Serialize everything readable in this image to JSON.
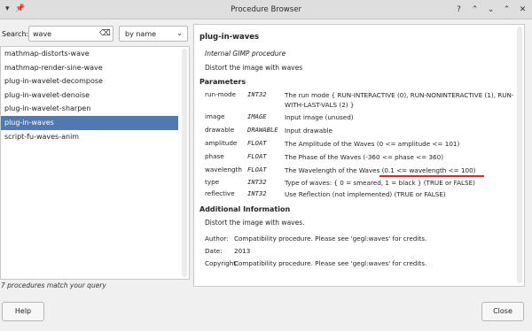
{
  "window": {
    "title": "Procedure Browser",
    "pin_glyph": "📌",
    "controls": [
      "?",
      "⌃",
      "⌄",
      "⌃",
      "✕"
    ]
  },
  "search": {
    "label": "Search:",
    "value": "wave",
    "clear_glyph": "⌫",
    "sort": "by name",
    "sort_chevron": "⌄"
  },
  "procedures": [
    "mathmap-distorts-wave",
    "mathmap-render-sine-wave",
    "plug-in-wavelet-decompose",
    "plug-in-wavelet-denoise",
    "plug-in-wavelet-sharpen",
    "plug-in-waves",
    "script-fu-waves-anim"
  ],
  "selected_procedure": "plug-in-waves",
  "status": "7 procedures match your query",
  "details": {
    "name": "plug-in-waves",
    "kind": "Internal GIMP procedure",
    "blurb": "Distort the image with waves",
    "parameters_heading": "Parameters",
    "parameters": [
      {
        "name": "run-mode",
        "type": "INT32",
        "desc": "The run mode { RUN-INTERACTIVE (0), RUN-NONINTERACTIVE (1), RUN-WITH-LAST-VALS (2) }"
      },
      {
        "name": "image",
        "type": "IMAGE",
        "desc": "Input image (unused)"
      },
      {
        "name": "drawable",
        "type": "DRAWABLE",
        "desc": "Input drawable"
      },
      {
        "name": "amplitude",
        "type": "FLOAT",
        "desc": "The Amplitude of the Waves (0 <= amplitude <= 101)"
      },
      {
        "name": "phase",
        "type": "FLOAT",
        "desc": "The Phase of the Waves (-360 <= phase <= 360)"
      },
      {
        "name": "wavelength",
        "type": "FLOAT",
        "desc": "The Wavelength of the Waves (0.1 <= wavelength <= 100)"
      },
      {
        "name": "type",
        "type": "INT32",
        "desc": "Type of waves: { 0 = smeared, 1 = black } (TRUE or FALSE)"
      },
      {
        "name": "reflective",
        "type": "INT32",
        "desc": "Use Reflection (not implemented) (TRUE or FALSE)"
      }
    ],
    "additional_heading": "Additional Information",
    "additional_desc": "Distort the image with waves.",
    "author_label": "Author:",
    "author": "Compatibility procedure. Please see 'gegl:waves' for credits.",
    "date_label": "Date:",
    "date": "2013",
    "copyright_label": "Copyright:",
    "copyright": "Compatibility procedure. Please see 'gegl:waves' for credits."
  },
  "buttons": {
    "help": "Help",
    "close": "Close"
  },
  "colors": {
    "selection": "#5278b0",
    "annotation_underline": "#d42a2a"
  }
}
